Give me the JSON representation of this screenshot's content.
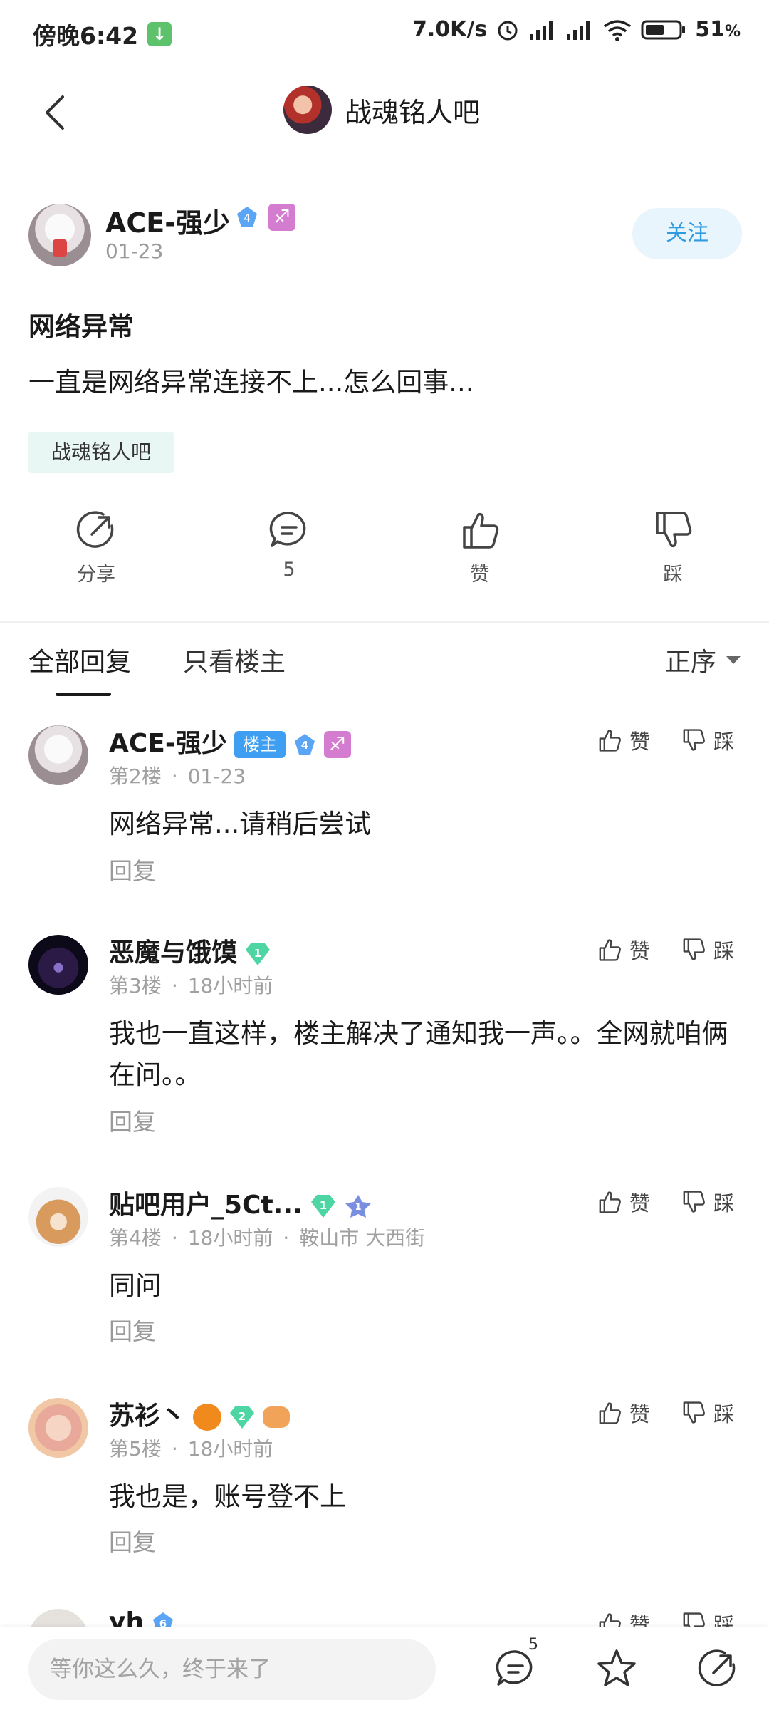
{
  "status_bar": {
    "time": "傍晚6:42",
    "net_speed": "7.0K/s",
    "battery": "51",
    "battery_unit": "%"
  },
  "nav": {
    "forum_title": "战魂铭人吧"
  },
  "post": {
    "author": "ACE-强少",
    "level": "4",
    "date": "01-23",
    "follow_label": "关注",
    "title": "网络异常",
    "body": "一直是网络异常连接不上...怎么回事...",
    "forum_tag": "战魂铭人吧"
  },
  "actions": {
    "share": "分享",
    "comments": "5",
    "like": "赞",
    "dislike": "踩"
  },
  "tabs": {
    "all": "全部回复",
    "host_only": "只看楼主",
    "sort": "正序"
  },
  "replies": [
    {
      "name": "ACE-强少",
      "host_label": "楼主",
      "level": "4",
      "floor": "第2楼",
      "time": "01-23",
      "text": "网络异常...请稍后尝试",
      "reply_label": "回复",
      "like": "赞",
      "dislike": "踩"
    },
    {
      "name": "恶魔与饿馍",
      "level": "1",
      "floor": "第3楼",
      "time": "18小时前",
      "text": "我也一直这样，楼主解决了通知我一声。。全网就咱俩在问。。",
      "reply_label": "回复",
      "like": "赞",
      "dislike": "踩"
    },
    {
      "name": "贴吧用户_5Ct...",
      "level": "1",
      "floor": "第4楼",
      "time": "18小时前",
      "location": "鞍山市 大西街",
      "text": "同问",
      "reply_label": "回复",
      "like": "赞",
      "dislike": "踩"
    },
    {
      "name": "苏衫丶",
      "level": "2",
      "floor": "第5楼",
      "time": "18小时前",
      "text": "我也是，账号登不上",
      "reply_label": "回复",
      "like": "赞",
      "dislike": "踩"
    },
    {
      "name": "yh",
      "level": "6",
      "like": "赞",
      "dislike": "踩"
    }
  ],
  "bottom": {
    "input_placeholder": "等你这么久，终于来了",
    "comment_count": "5"
  },
  "colors": {
    "accent_blue": "#2f9ae0",
    "host_badge": "#3d9ef2",
    "tag_bg": "#e8f7f3",
    "level_green": "#4dd6a3",
    "level_blue": "#5aa5f5"
  }
}
